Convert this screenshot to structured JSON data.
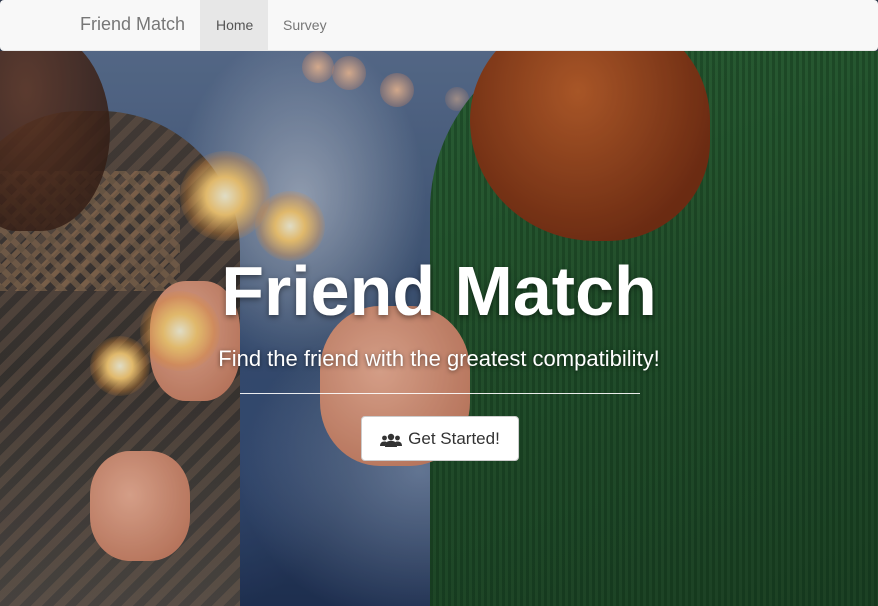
{
  "navbar": {
    "brand": "Friend Match",
    "items": [
      {
        "label": "Home",
        "active": true
      },
      {
        "label": "Survey",
        "active": false
      }
    ]
  },
  "hero": {
    "title": "Friend Match",
    "subtitle": "Find the friend with the greatest compatibility!",
    "cta": {
      "icon": "users-icon",
      "label": "Get Started!"
    }
  },
  "colors": {
    "navbar_bg": "#f8f8f8",
    "active_tab_bg": "#e7e7e7",
    "brand_text": "#777777",
    "hero_text": "#ffffff",
    "button_bg": "#ffffff"
  }
}
